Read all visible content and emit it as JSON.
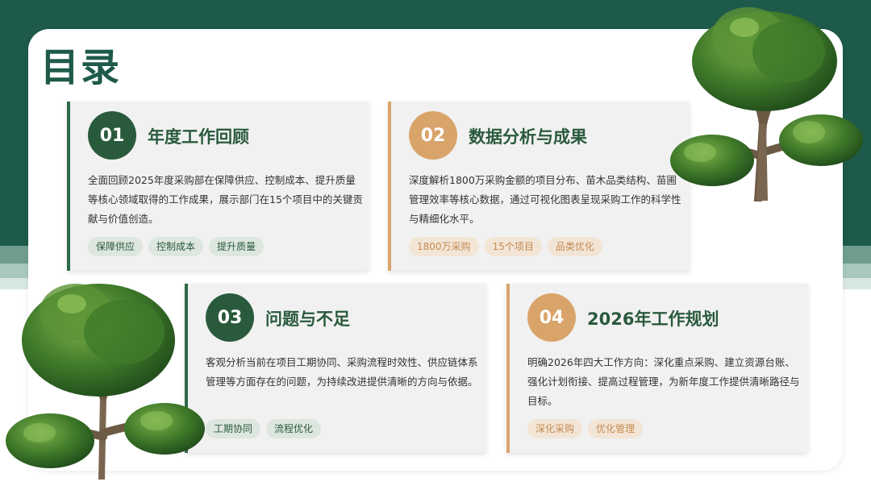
{
  "title": "目录",
  "cards": [
    {
      "number": "01",
      "title": "年度工作回顾",
      "desc": "全面回顾2025年度采购部在保障供应、控制成本、提升质量等核心领域取得的工作成果，展示部门在15个项目中的关键贡献与价值创造。",
      "tags": [
        "保障供应",
        "控制成本",
        "提升质量"
      ],
      "accent": "#2a5a3c"
    },
    {
      "number": "02",
      "title": "数据分析与成果",
      "desc": "深度解析1800万采购金额的项目分布、苗木品类结构、苗圃管理效率等核心数据，通过可视化图表呈现采购工作的科学性与精细化水平。",
      "tags": [
        "1800万采购",
        "15个项目",
        "品类优化"
      ],
      "accent": "#d9a46a"
    },
    {
      "number": "03",
      "title": "问题与不足",
      "desc": "客观分析当前在项目工期协同、采购流程时效性、供应链体系管理等方面存在的问题，为持续改进提供清晰的方向与依据。",
      "tags": [
        "工期协同",
        "流程优化"
      ],
      "accent": "#2a5a3c"
    },
    {
      "number": "04",
      "title": "2026年工作规划",
      "desc": "明确2026年四大工作方向：深化重点采购、建立资源台账、强化计划衔接、提高过程管理，为新年度工作提供清晰路径与目标。",
      "tags": [
        "深化采购",
        "优化管理"
      ],
      "accent": "#d9a46a"
    }
  ],
  "colors": {
    "dark_green": "#1e5a4a",
    "card_green": "#2a5a3c",
    "card_orange": "#d9a46a"
  },
  "decorations": [
    "tree-image-top-right",
    "tree-image-bottom-left"
  ]
}
